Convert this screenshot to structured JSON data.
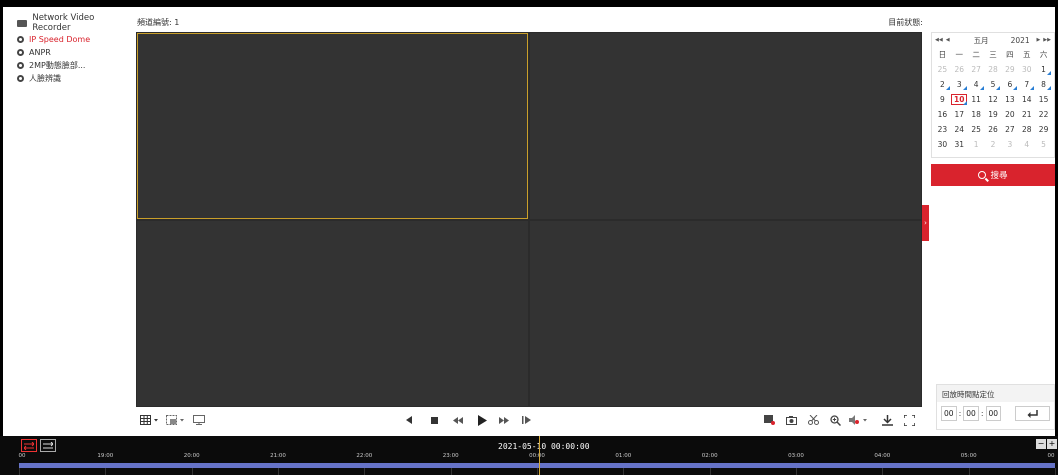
{
  "sidebar": {
    "title": "Network Video Recorder",
    "cameras": [
      {
        "label": "IP Speed Dome",
        "active": true
      },
      {
        "label": "ANPR",
        "active": false
      },
      {
        "label": "2MP動態臉部...",
        "active": false
      },
      {
        "label": "人臉辨識",
        "active": false
      }
    ]
  },
  "header": {
    "channel_label": "頻道編號: 1",
    "status_label": "目前狀態:"
  },
  "calendar": {
    "month": "五月",
    "year": "2021",
    "weekdays": [
      "日",
      "一",
      "二",
      "三",
      "四",
      "五",
      "六"
    ],
    "rows": [
      [
        {
          "d": "25",
          "m": true
        },
        {
          "d": "26",
          "m": true
        },
        {
          "d": "27",
          "m": true
        },
        {
          "d": "28",
          "m": true
        },
        {
          "d": "29",
          "m": true
        },
        {
          "d": "30",
          "m": true
        },
        {
          "d": "1",
          "r": true
        }
      ],
      [
        {
          "d": "2",
          "r": true
        },
        {
          "d": "3",
          "r": true
        },
        {
          "d": "4",
          "r": true
        },
        {
          "d": "5",
          "r": true
        },
        {
          "d": "6",
          "r": true
        },
        {
          "d": "7",
          "r": true
        },
        {
          "d": "8",
          "r": true
        }
      ],
      [
        {
          "d": "9"
        },
        {
          "d": "10",
          "t": true,
          "r": true
        },
        {
          "d": "11"
        },
        {
          "d": "12"
        },
        {
          "d": "13"
        },
        {
          "d": "14"
        },
        {
          "d": "15"
        }
      ],
      [
        {
          "d": "16"
        },
        {
          "d": "17"
        },
        {
          "d": "18"
        },
        {
          "d": "19"
        },
        {
          "d": "20"
        },
        {
          "d": "21"
        },
        {
          "d": "22"
        }
      ],
      [
        {
          "d": "23"
        },
        {
          "d": "24"
        },
        {
          "d": "25"
        },
        {
          "d": "26"
        },
        {
          "d": "27"
        },
        {
          "d": "28"
        },
        {
          "d": "29"
        }
      ],
      [
        {
          "d": "30"
        },
        {
          "d": "31"
        },
        {
          "d": "1",
          "m": true
        },
        {
          "d": "2",
          "m": true
        },
        {
          "d": "3",
          "m": true
        },
        {
          "d": "4",
          "m": true
        },
        {
          "d": "5",
          "m": true
        }
      ]
    ],
    "nav_prev_year": "◀◀",
    "nav_prev_month": "◀",
    "nav_next_month": "▶",
    "nav_next_year": "▶▶"
  },
  "search": {
    "label": "搜尋"
  },
  "locate": {
    "title": "回放時間點定位",
    "hour": "00",
    "minute": "00",
    "second": "00",
    "sep": ":"
  },
  "timeline": {
    "current": "2021-05-10 00:00:00",
    "ticks": [
      "00",
      "19:00",
      "20:00",
      "21:00",
      "22:00",
      "23:00",
      "00:00",
      "01:00",
      "02:00",
      "03:00",
      "04:00",
      "05:00",
      "00"
    ],
    "zoom_out": "−",
    "zoom_in": "+"
  },
  "colors": {
    "accent": "#d9232d",
    "record_marker": "#2a7fd4",
    "timeline_track": "#6673c7",
    "selected_pane_border": "#c99f2a"
  }
}
